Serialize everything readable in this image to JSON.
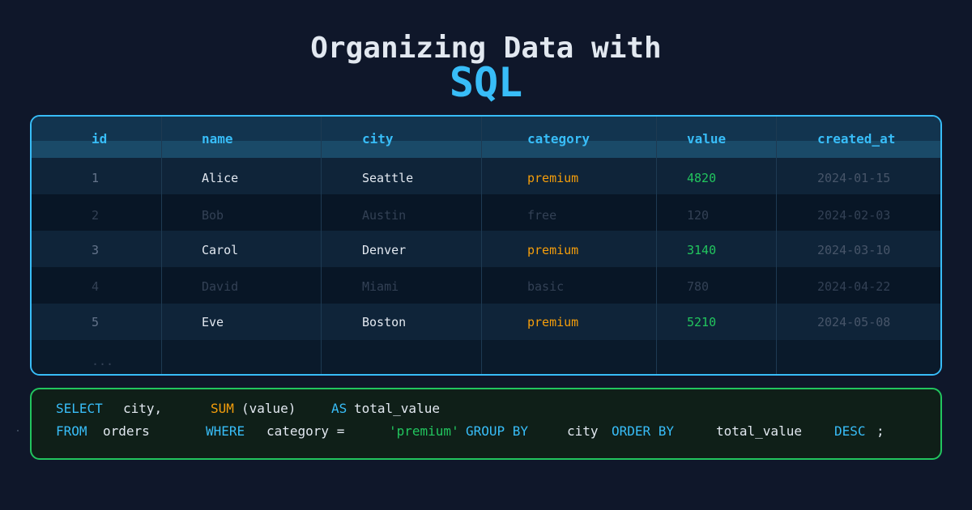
{
  "title": {
    "line1": "Organizing Data with",
    "line2": "SQL"
  },
  "table": {
    "columns": [
      "id",
      "name",
      "city",
      "category",
      "value",
      "created_at"
    ],
    "rows": [
      [
        "1",
        "Alice",
        "Seattle",
        "premium",
        "4820",
        "2024-01-15"
      ],
      [
        "2",
        "Bob",
        "Austin",
        "free",
        "120",
        "2024-02-03"
      ],
      [
        "3",
        "Carol",
        "Denver",
        "premium",
        "3140",
        "2024-03-10"
      ],
      [
        "4",
        "David",
        "Miami",
        "basic",
        "780",
        "2024-04-22"
      ],
      [
        "5",
        "Eve",
        "Boston",
        "premium",
        "5210",
        "2024-05-08"
      ]
    ],
    "ellipsis": "..."
  },
  "sql": {
    "line1": {
      "select": "SELECT",
      "city": "city,",
      "sum": "SUM",
      "arg": "(value)",
      "as": "AS",
      "alias": "total_value"
    },
    "line2": {
      "from": "FROM",
      "table": "orders",
      "where": "WHERE",
      "cond": "category =",
      "literal": "'premium'",
      "groupby": "GROUP BY",
      "city": "city",
      "orderby": "ORDER BY",
      "alias": "total_value",
      "desc": "DESC",
      "semi": ";"
    }
  },
  "colors": {
    "background": "#0f172a",
    "accent": "#38bdf8",
    "premium": "#f59e0b",
    "value": "#22c55e"
  }
}
